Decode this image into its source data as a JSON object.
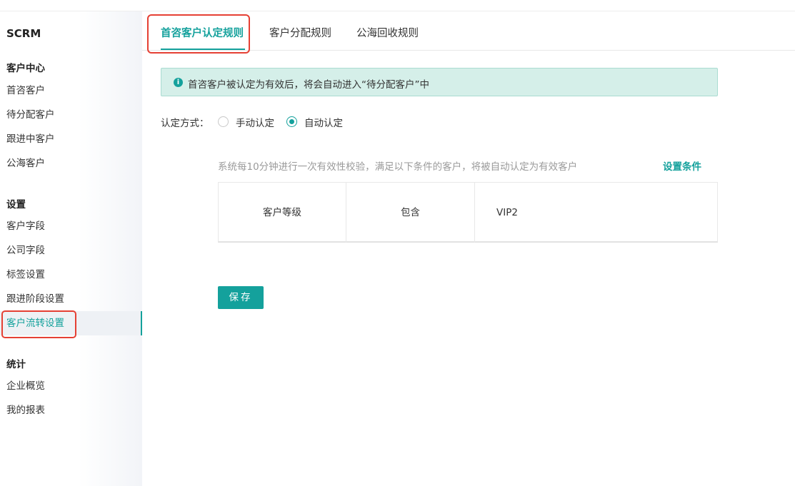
{
  "sidebar": {
    "brand": "SCRM",
    "groups": [
      {
        "title": "客户中心",
        "items": [
          "首咨客户",
          "待分配客户",
          "跟进中客户",
          "公海客户"
        ]
      },
      {
        "title": "设置",
        "items": [
          "客户字段",
          "公司字段",
          "标签设置",
          "跟进阶段设置",
          "客户流转设置"
        ]
      },
      {
        "title": "统计",
        "items": [
          "企业概览",
          "我的报表"
        ]
      }
    ],
    "active_item": "客户流转设置"
  },
  "tabs": [
    {
      "label": "首咨客户认定规则",
      "active": true
    },
    {
      "label": "客户分配规则",
      "active": false
    },
    {
      "label": "公海回收规则",
      "active": false
    }
  ],
  "notice": {
    "icon": "info-icon",
    "text": "首咨客户被认定为有效后，将会自动进入“待分配客户”中"
  },
  "method": {
    "label": "认定方式：",
    "options": [
      {
        "label": "手动认定",
        "checked": false
      },
      {
        "label": "自动认定",
        "checked": true
      }
    ]
  },
  "condition": {
    "description": "系统每10分钟进行一次有效性校验，满足以下条件的客户，将被自动认定为有效客户",
    "set_label": "设置条件",
    "rows": [
      {
        "field": "客户等级",
        "operator": "包含",
        "value": "VIP2"
      }
    ]
  },
  "save_label": "保存",
  "colors": {
    "accent": "#14a19c",
    "highlight": "#e54034",
    "notice_bg": "#d5efe9"
  }
}
